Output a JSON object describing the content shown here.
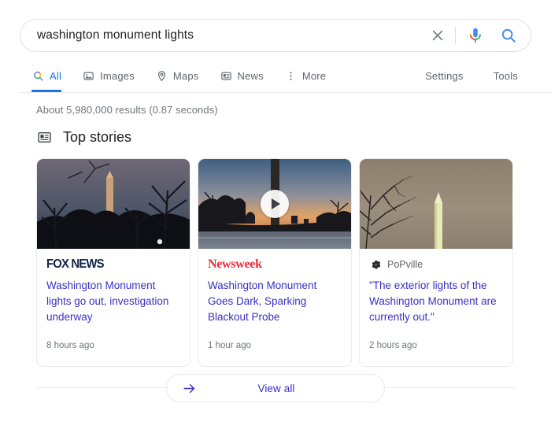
{
  "search": {
    "query": "washington monument lights",
    "placeholder": "Search",
    "clear_icon": "close-icon",
    "mic_icon": "microphone-icon",
    "search_icon": "search-icon"
  },
  "nav": {
    "tabs": [
      {
        "label": "All",
        "icon": "search-icon",
        "active": true
      },
      {
        "label": "Images",
        "icon": "image-icon",
        "active": false
      },
      {
        "label": "Maps",
        "icon": "location-pin-icon",
        "active": false
      },
      {
        "label": "News",
        "icon": "newspaper-icon",
        "active": false
      },
      {
        "label": "More",
        "icon": "more-vertical-icon",
        "active": false
      }
    ],
    "settings_label": "Settings",
    "tools_label": "Tools",
    "active_color": "#1a73e8"
  },
  "result_stats": "About 5,980,000 results (0.87 seconds)",
  "top_stories": {
    "icon": "newspaper-icon",
    "title": "Top stories",
    "cards": [
      {
        "source": "FOX NEWS",
        "source_style": "fox",
        "headline": "Washington Monument lights go out, investigation underway",
        "timestamp": "8 hours ago",
        "has_video": false,
        "image_alt": "washington-monument-at-dusk-thumbnail"
      },
      {
        "source": "Newsweek",
        "source_style": "newsweek",
        "headline": "Washington Monument Goes Dark, Sparking Blackout Probe",
        "timestamp": "1 hour ago",
        "has_video": true,
        "image_alt": "washington-monument-sunset-video-thumbnail"
      },
      {
        "source": "PoPville",
        "source_style": "popville",
        "headline": "\"The exterior lights of the Washington Monument are currently out.\"",
        "timestamp": "2 hours ago",
        "has_video": false,
        "image_alt": "washington-monument-daytime-thumbnail"
      }
    ],
    "view_all_label": "View all",
    "view_all_icon": "arrow-right-icon",
    "link_color": "#3730c4"
  }
}
